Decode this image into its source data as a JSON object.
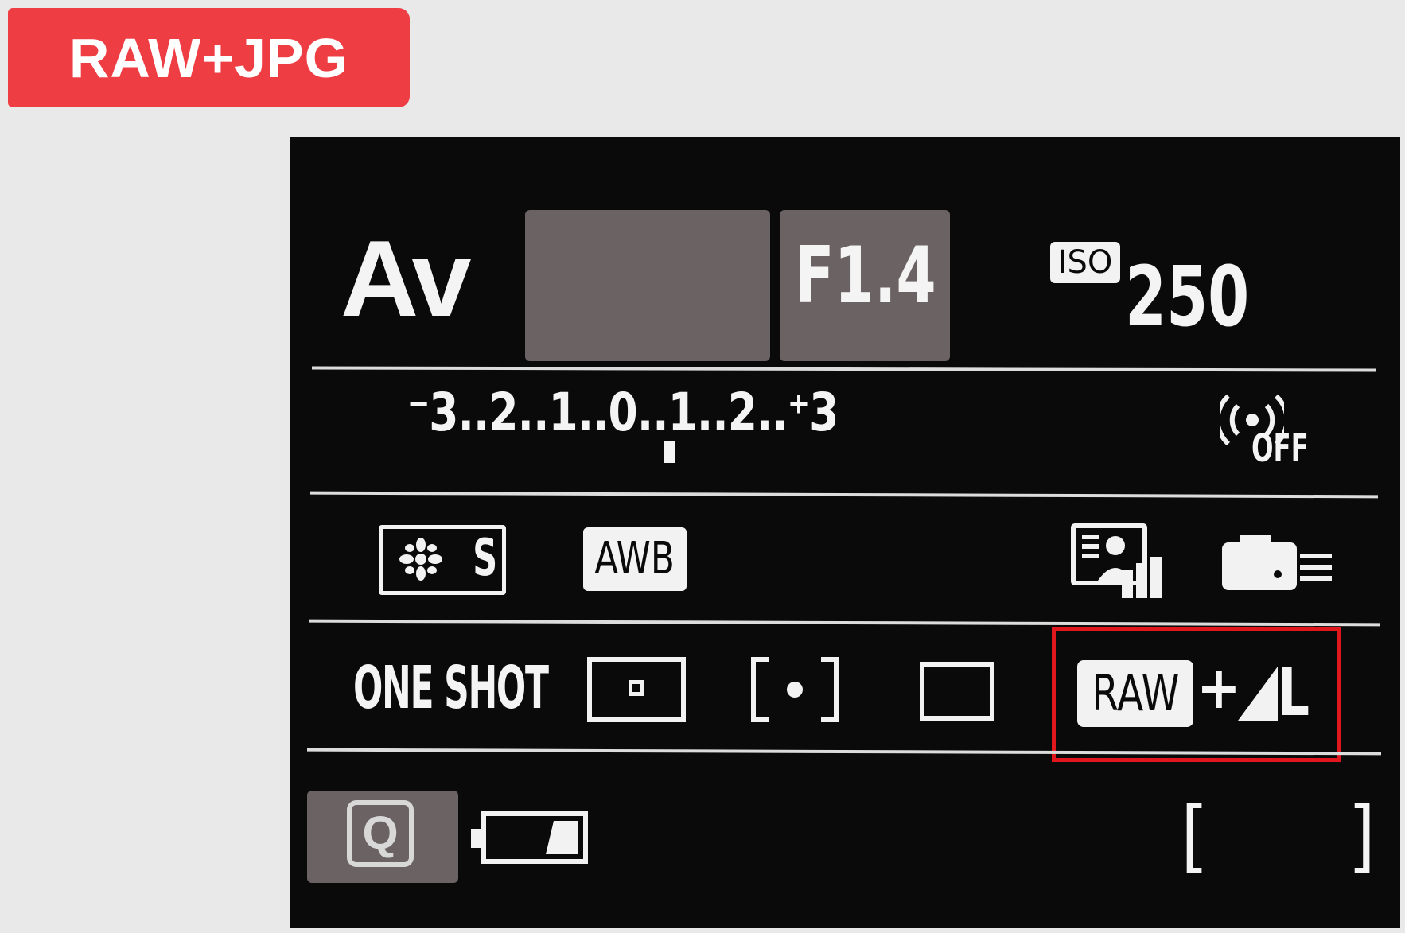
{
  "title_badge": {
    "label": "RAW+JPG",
    "color": "#ee3d43"
  },
  "screen": {
    "shooting_mode": "Av",
    "shutter_speed": "",
    "aperture": "F1.4",
    "iso": {
      "label": "ISO",
      "value": "250"
    },
    "exposure_compensation": {
      "scale": "⁻3..2..1..0..1..2..⁺3",
      "value": 0
    },
    "wireless": {
      "icon": "wifi-signal-icon",
      "status": "OFF"
    },
    "picture_style": {
      "label": "S",
      "icon": "picture-style-icon"
    },
    "white_balance": "AWB",
    "icons_row3": [
      "display-level-icon",
      "camera-settings-icon"
    ],
    "af_operation": "ONE SHOT",
    "metering_modes": [
      "spot-metering-icon",
      "partial-metering-icon",
      "center-weighted-metering-icon"
    ],
    "image_quality": {
      "raw_label": "RAW",
      "plus": "+",
      "jpg_size": "L",
      "highlight_color": "#e1171e"
    },
    "quick_control_label": "Q",
    "battery_icon": "battery-icon",
    "shots_remaining": {
      "open": "[",
      "close": "]",
      "value": ""
    }
  }
}
